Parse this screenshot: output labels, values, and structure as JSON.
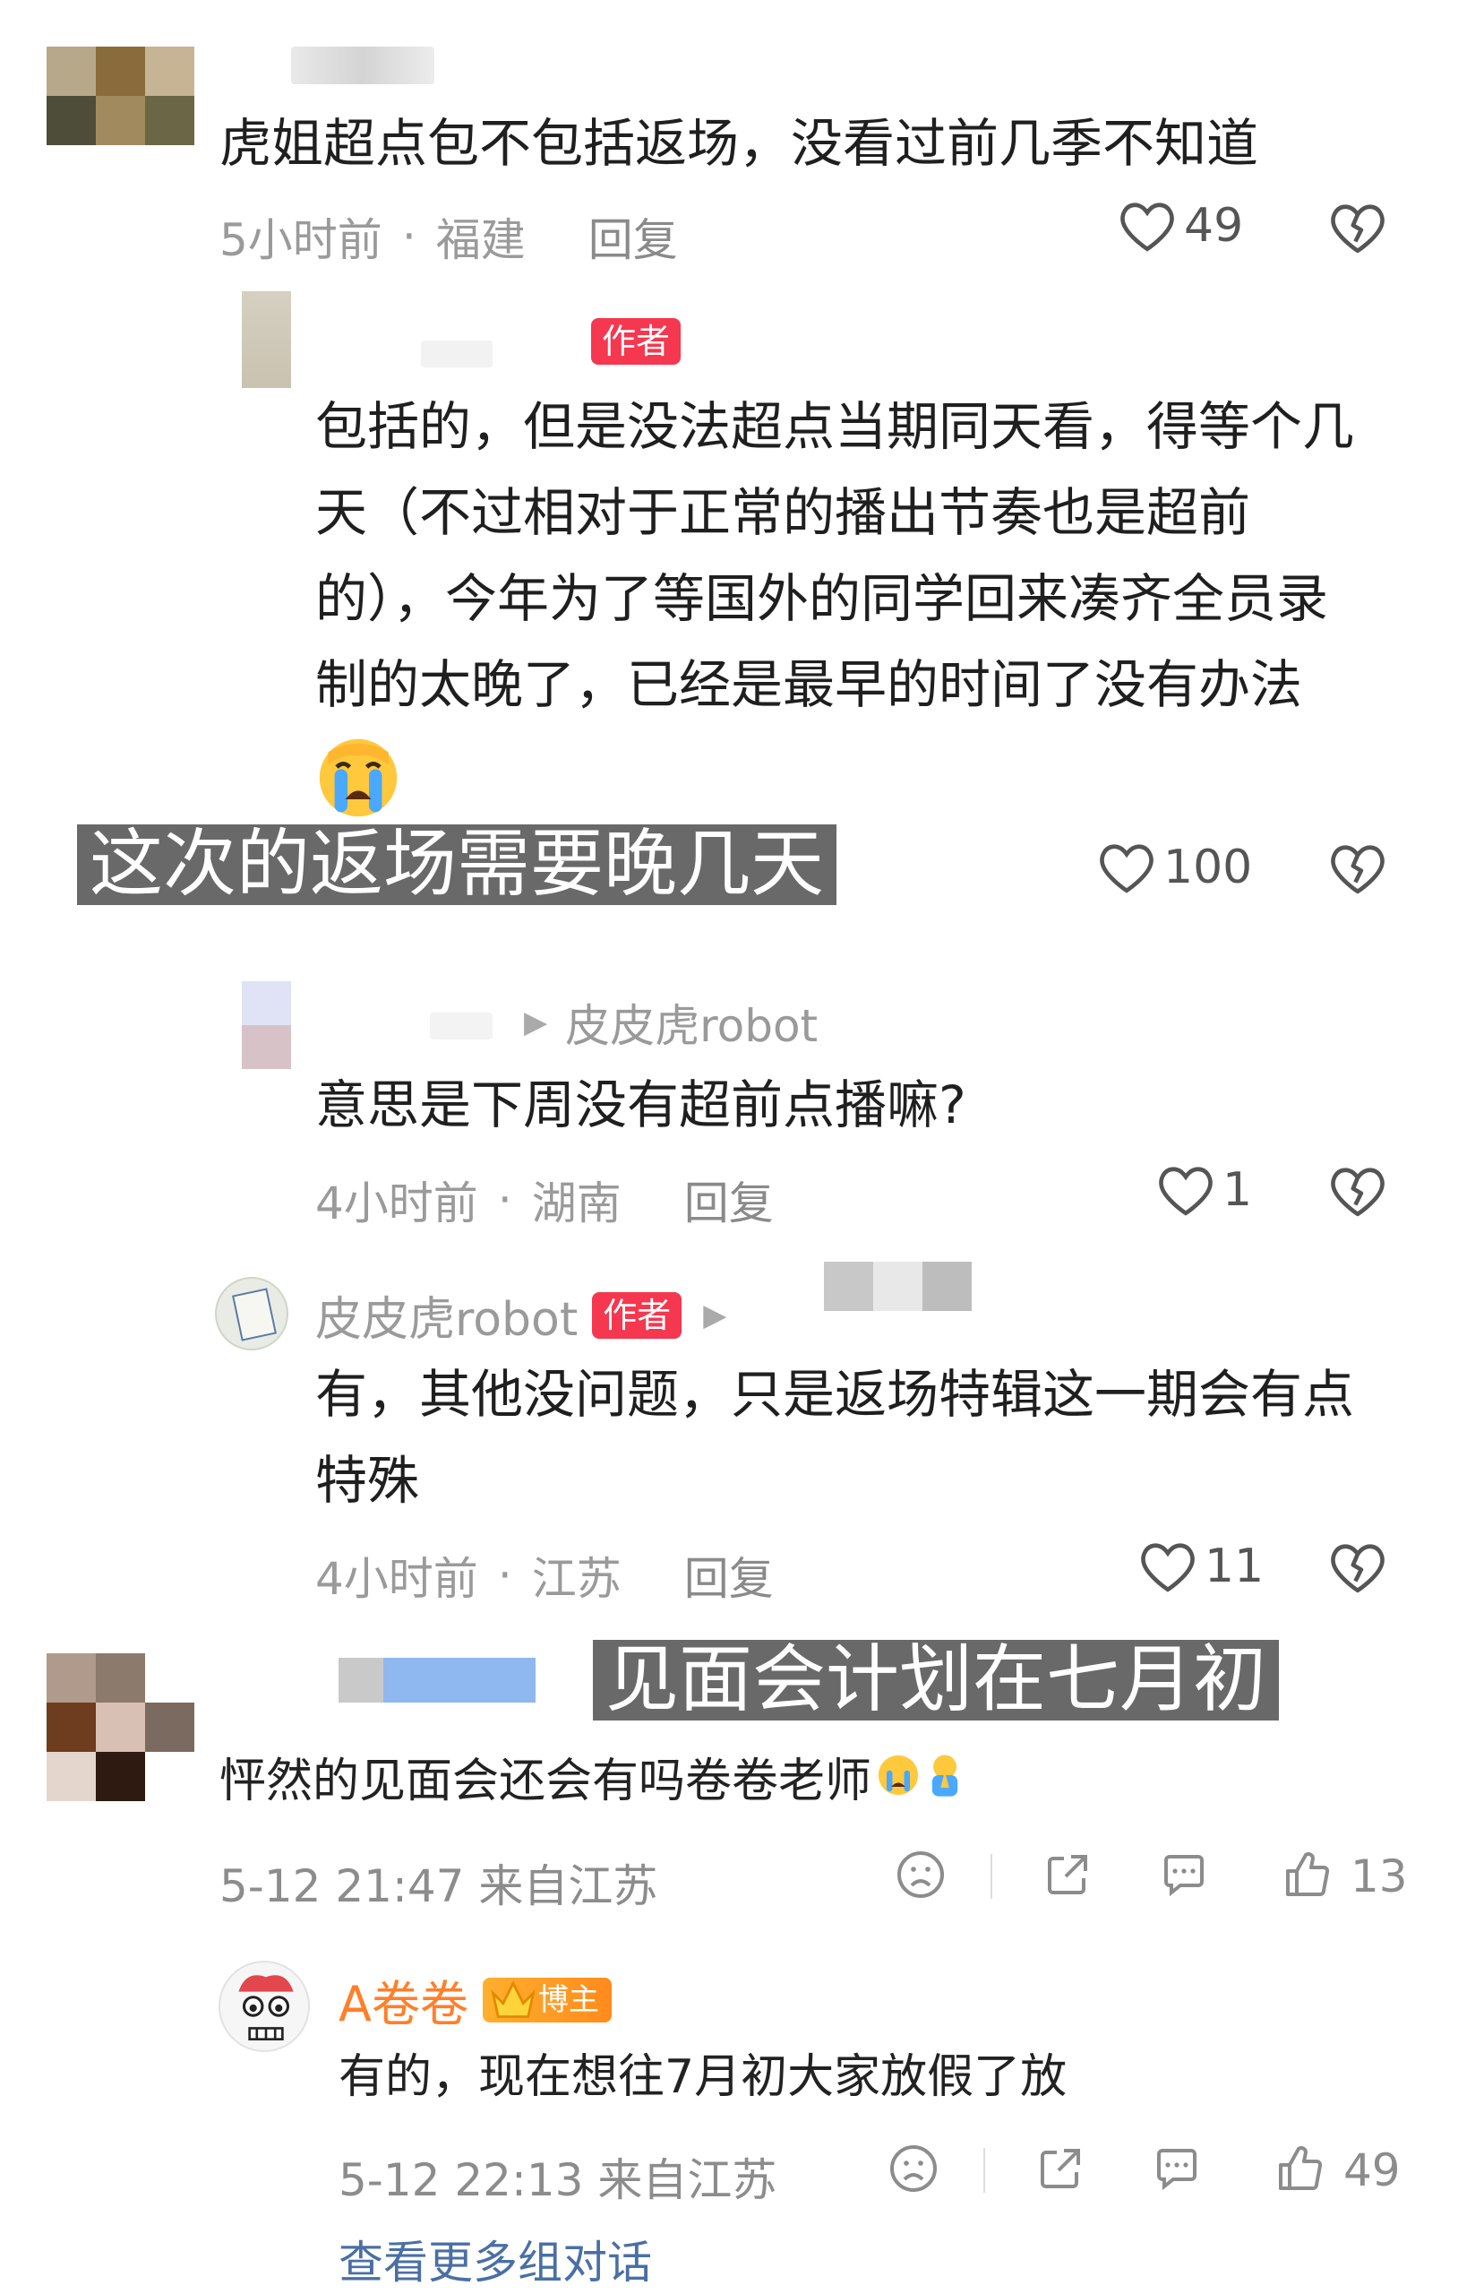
{
  "comments": {
    "c1": {
      "text": "虎姐超点包不包括返场，没看过前几季不知道",
      "time": "5小时前",
      "sep": "·",
      "location": "福建",
      "reply": "回复",
      "likes": "49"
    },
    "r1": {
      "author_badge": "作者",
      "text_lines": [
        "包括的，但是没法超点当期同天看，得等个几",
        "天（不过相对于正常的播出节奏也是超前",
        "的），今年为了等国外的同学回来凑齐全员录",
        "制的太晚了，已经是最早的时间了没有办法"
      ],
      "emoji": "crying-face",
      "likes": "100"
    },
    "r2": {
      "reply_to": "皮皮虎robot",
      "text": "意思是下周没有超前点播嘛?",
      "time": "4小时前",
      "sep": "·",
      "location": "湖南",
      "reply": "回复",
      "likes": "1"
    },
    "r3": {
      "name": "皮皮虎robot",
      "author_badge": "作者",
      "text_lines": [
        "有，其他没问题，只是返场特辑这一期会有点",
        "特殊"
      ],
      "time": "4小时前",
      "sep": "·",
      "location": "江苏",
      "reply": "回复",
      "likes": "11"
    }
  },
  "weibo": {
    "c1": {
      "text": "怦然的见面会还会有吗卷卷老师",
      "datetime": "5-12 21:47 来自江苏",
      "likes": "13"
    },
    "r1": {
      "name": "A卷卷",
      "badge": "博主",
      "text": "有的，现在想往7月初大家放假了放",
      "datetime": "5-12 22:13 来自江苏",
      "likes": "49"
    },
    "more_link": "查看更多组对话"
  },
  "overlays": {
    "o1": "这次的返场需要晚几天",
    "o2": "见面会计划在七月初"
  },
  "colors": {
    "author_badge": "#f5374f",
    "link": "#4a6fa5",
    "blogger_orange": "#ff7f2a"
  }
}
